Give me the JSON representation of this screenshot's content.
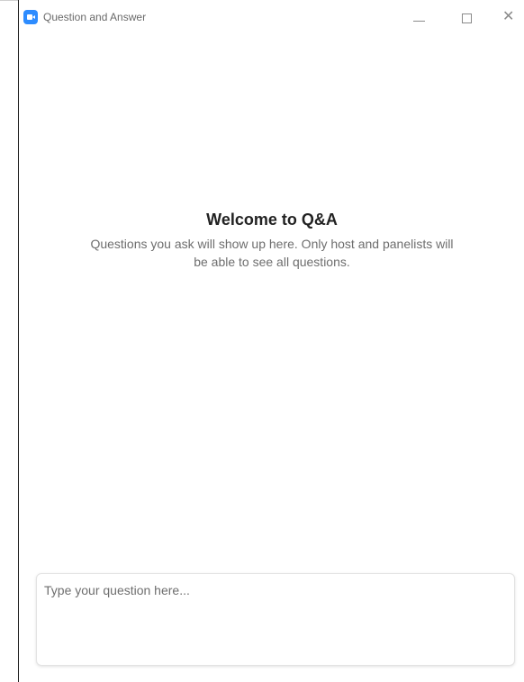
{
  "window": {
    "title": "Question and Answer",
    "app_icon": "zoom-app-icon",
    "controls": {
      "minimize": "minimize-icon",
      "maximize": "maximize-icon",
      "close_symbol": "✕"
    }
  },
  "welcome": {
    "title": "Welcome to Q&A",
    "description": "Questions you ask will show up here. Only host and panelists will be able to see all questions."
  },
  "question_input": {
    "placeholder": "Type your question here...",
    "value": ""
  },
  "colors": {
    "accent": "#2d8cff",
    "title_text": "#222222",
    "secondary_text": "#6e6e6e"
  }
}
